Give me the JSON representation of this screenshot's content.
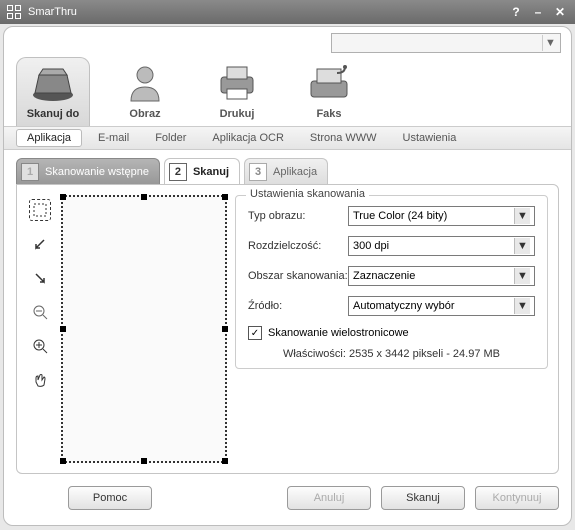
{
  "window": {
    "title": "SmarThru"
  },
  "main_tabs": {
    "scan_to": "Skanuj do",
    "image": "Obraz",
    "print": "Drukuj",
    "fax": "Faks"
  },
  "sub_tabs": {
    "application": "Aplikacja",
    "email": "E-mail",
    "folder": "Folder",
    "ocr_app": "Aplikacja OCR",
    "web_page": "Strona WWW",
    "settings": "Ustawienia"
  },
  "steps": {
    "s1": {
      "num": "1",
      "label": "Skanowanie wstępne"
    },
    "s2": {
      "num": "2",
      "label": "Skanuj"
    },
    "s3": {
      "num": "3",
      "label": "Aplikacja"
    }
  },
  "scan_settings": {
    "legend": "Ustawienia skanowania",
    "image_type_label": "Typ obrazu:",
    "image_type_value": "True Color (24 bity)",
    "resolution_label": "Rozdzielczość:",
    "resolution_value": "300 dpi",
    "scan_area_label": "Obszar skanowania:",
    "scan_area_value": "Zaznaczenie",
    "source_label": "Źródło:",
    "source_value": "Automatyczny wybór",
    "multipage_label": "Skanowanie wielostronicowe",
    "multipage_checked": true,
    "properties": "Właściwości: 2535 x 3442 pikseli - 24.97 MB"
  },
  "buttons": {
    "help": "Pomoc",
    "cancel": "Anuluj",
    "scan": "Skanuj",
    "continue": "Kontynuuj"
  }
}
